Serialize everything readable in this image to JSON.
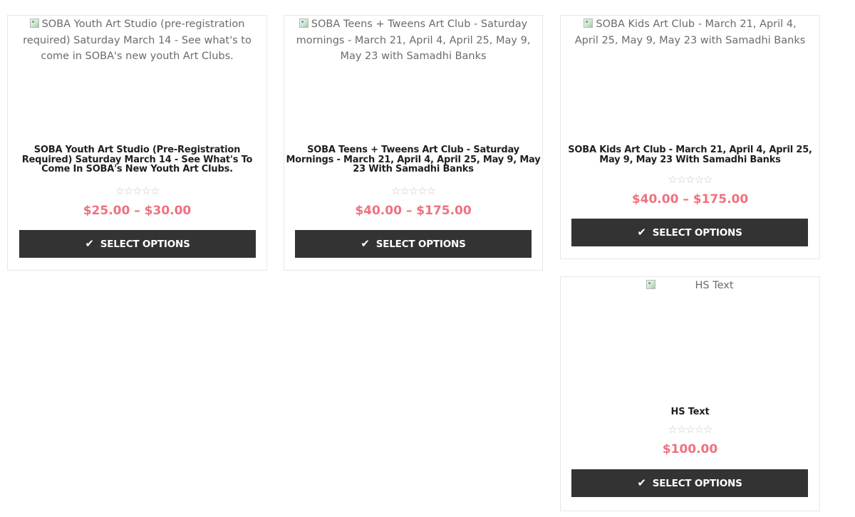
{
  "products": [
    {
      "image_alt": "SOBA Youth Art Studio (pre-registration required) Saturday March 14 - See what's to come in SOBA's new youth Art Clubs.",
      "title": "SOBA Youth Art Studio (Pre-Registration Required) Saturday March 14 - See What's To Come In SOBA's New Youth Art Clubs.",
      "rating": 0,
      "rating_icon": "star-outline-icon",
      "price": "$25.00 – $30.00",
      "button_label": "SELECT OPTIONS",
      "button_icon": "checkmark-icon"
    },
    {
      "image_alt": "SOBA Teens + Tweens Art Club - Saturday mornings - March 21, April 4, April 25, May 9, May 23 with Samadhi Banks",
      "title": "SOBA Teens + Tweens Art Club - Saturday Mornings - March 21, April 4, April 25, May 9, May 23 With Samadhi Banks",
      "rating": 0,
      "rating_icon": "star-outline-icon",
      "price": "$40.00 – $175.00",
      "button_label": "SELECT OPTIONS",
      "button_icon": "checkmark-icon"
    },
    {
      "image_alt": "SOBA Kids Art Club - March 21, April 4, April 25, May 9, May 23 with Samadhi Banks",
      "title": "SOBA Kids Art Club - March 21, April 4, April 25, May 9, May 23 With Samadhi Banks",
      "rating": 0,
      "rating_icon": "star-outline-icon",
      "price": "$40.00 – $175.00",
      "button_label": "SELECT OPTIONS",
      "button_icon": "checkmark-icon"
    },
    {
      "image_alt": "HS Text",
      "title": "HS Text",
      "rating": 0,
      "rating_icon": "star-outline-icon",
      "price": "$100.00",
      "button_label": "SELECT OPTIONS",
      "button_icon": "checkmark-icon"
    }
  ],
  "colors": {
    "price": "#f0707e",
    "button_bg": "#333333",
    "button_text": "#ffffff",
    "card_border": "#e7e7e7",
    "star_empty": "#c8c8c8"
  }
}
